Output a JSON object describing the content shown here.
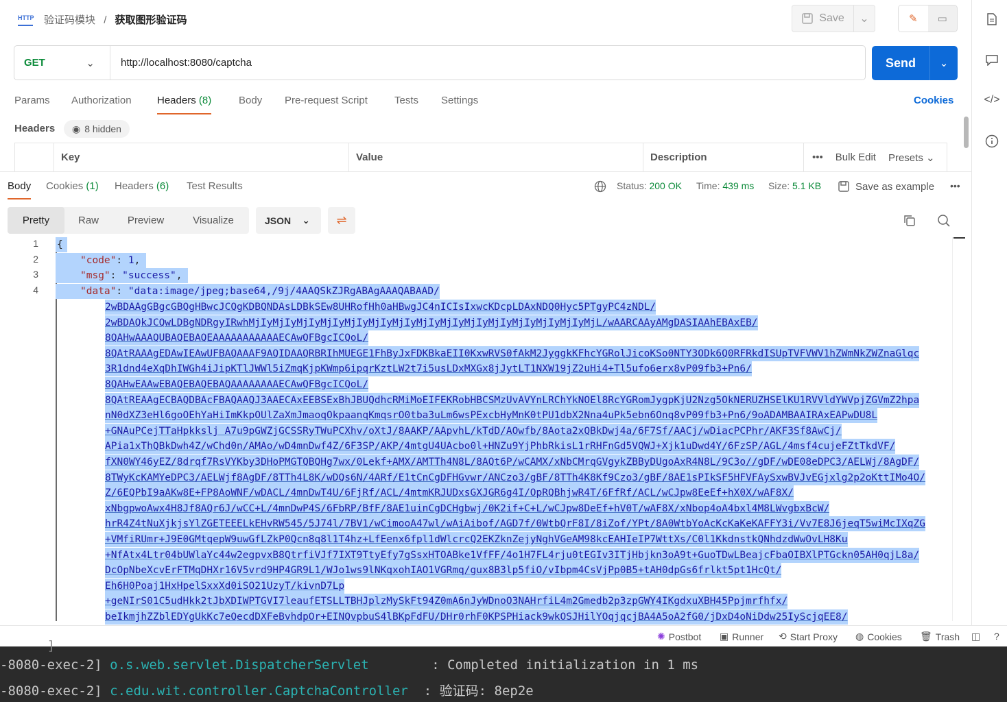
{
  "header": {
    "http_badge": "HTTP",
    "breadcrumb_parent": "验证码模块",
    "breadcrumb_sep": "/",
    "breadcrumb_current": "获取图形验证码",
    "save_label": "Save"
  },
  "request": {
    "method": "GET",
    "url": "http://localhost:8080/captcha",
    "send_label": "Send"
  },
  "req_tabs": [
    {
      "label": "Params"
    },
    {
      "label": "Authorization"
    },
    {
      "label": "Headers",
      "count": "(8)"
    },
    {
      "label": "Body"
    },
    {
      "label": "Pre-request Script"
    },
    {
      "label": "Tests"
    },
    {
      "label": "Settings"
    }
  ],
  "cookies_link": "Cookies",
  "headers_section": {
    "title": "Headers",
    "hidden": "8 hidden",
    "cols": [
      "Key",
      "Value",
      "Description"
    ],
    "bulk_edit": "Bulk Edit",
    "presets": "Presets"
  },
  "resp_tabs": [
    {
      "label": "Body"
    },
    {
      "label": "Cookies",
      "count": "(1)"
    },
    {
      "label": "Headers",
      "count": "(6)"
    },
    {
      "label": "Test Results"
    }
  ],
  "resp_meta": {
    "status_label": "Status:",
    "status_value": "200 OK",
    "time_label": "Time:",
    "time_value": "439 ms",
    "size_label": "Size:",
    "size_value": "5.1 KB",
    "save_example": "Save as example"
  },
  "view_modes": [
    "Pretty",
    "Raw",
    "Preview",
    "Visualize"
  ],
  "format": "JSON",
  "code": {
    "line_numbers": [
      "1",
      "2",
      "3",
      "4"
    ],
    "brace": "{",
    "code_key": "\"code\"",
    "code_val": "1",
    "msg_key": "\"msg\"",
    "msg_val": "\"success\"",
    "data_key": "\"data\"",
    "data_first": "\"data:image/jpeg;base64,/9j/4AAQSkZJRgABAgAAAQABAAD/",
    "data_lines": [
      "2wBDAAgGBgcGBQgHBwcJCQgKDBQNDAsLDBkSEw8UHRofHh0aHBwgJC4nICIsIxwcKDcpLDAxNDQ0Hyc5PTgyPC4zNDL/",
      "2wBDAQkJCQwLDBgNDRgyIRwhMjIyMjIyMjIyMjIyMjIyMjIyMjIyMjIyMjIyMjIyMjIyMjIyMjIyMjIyMjL/wAARCAAyAMgDASIAAhEBAxEB/",
      "8QAHwAAAQUBAQEBAQEAAAAAAAAAAAECAwQFBgcICQoL/",
      "8QAtRAAAgEDAwIEAwUFBAQAAAF9AQIDAAQRBRIhMUEGE1FhByJxFDKBkaEII0KxwRVS0fAkM2JyggkKFhcYGRolJicoKSo0NTY3ODk6Q0RFRkdISUpTVFVWV1hZWmNkZWZnaGlqc",
      "3R1dnd4eXqDhIWGh4iJipKTlJWWl5iZmqKjpKWmp6ipqrKztLW2t7i5usLDxMXGx8jJytLT1NXW19jZ2uHi4+Tl5ufo6erx8vP09fb3+Pn6/",
      "8QAHwEAAwEBAQEBAQEBAQAAAAAAAAECAwQFBgcICQoL/",
      "8QAtREAAgECBAQDBAcFBAQAAQJ3AAECAxEEBSExBhJBUQdhcRMiMoEIFEKRobHBCSMzUvAVYnLRChYkNOEl8RcYGRomJygpKjU2Nzg5OkNERUZHSElKU1RVVldYWVpjZGVmZ2hpa",
      "nN0dXZ3eHl6goOEhYaHiImKkpOUlZaXmJmaoqOkpaanqKmqsrO0tba3uLm6wsPExcbHyMnK0tPU1dbX2Nna4uPk5ebn6Onq8vP09fb3+Pn6/9oADAMBAAIRAxEAPwDU8L",
      "+GNAuPCejTTaHpkkslj A7u9pGWZjGCSSRyTWuPCXhv/oXtJ/8AAKP/AApvhL/kTdD/AOwfb/8Aota2xQBkDwj4a/6F7Sf/AACj/wDiacPCPhr/AKF3Sf8AwCj/",
      "APia1xThQBkDwh4Z/wChd0n/AMAo/wD4mnDwf4Z/6F3SP/AKP/4mtgU4UAcbo0l+HNZu9YjPhbRkisL1rRHFnGd5VQWJ+Xjk1uDwd4Y/6FzSP/AGL/4msf4cujeFZtTkdVF/",
      "fXN0WY46yEZ/8drqf7RsVYKby3DHoPMGTQBQHg7wx/0Lekf+AMX/AMTTh4N8L/8AQt6P/wCAMX/xNbCMrqGVgykZBByDUgoAxR4N8L/9C3o//gDF/wDE08eDPC3/AELWj/8AgDF/",
      "8TWyKcKAMYeDPC3/AELWjf8AgDF/8TTh4L8K/wDQs6N/4ARf/E1tCnCgDFHGvwr/ANCzo3/gBF/8TTh4K8Kf9Czo3/gBF/8AE1sPIkSF5HFVFAySxwBVJvEGjxlg2p2oKttIMo4O/",
      "Z/6EQPbI9aAKw8E+FP8AoWNF/wDACL/4mnDwT4U/6FjRf/ACL/4mtmKRJUDxsGXJGR6g4I/OpRQBhjwR4T/6FfRf/ACL/wCJpw8EeEf+hX0X/wAF8X/",
      "xNbgpwoAwx4H8Jf8AQr6J/wCC+L/4mnDwP4S/6FbRP/BfF/8AE1uinCgDCHgbwj/0K2if+C+L/wCJpw8DeEf+hV0T/wAF8X/xNbop4oA4bxl4M8LWvgbxBcW/",
      "hrR4Z4tNuXjkjsYlZGETEEELkEHvRW545/5J74l/7BV1/wCimooA47wl/wAiAibof/AGD7f/0WtbQrF8I/8iZof/YPt/8A0WtbYoAcKcKaKeKAFFY3i/Vv7E8J6jeqT5wiMcIXqZG",
      "+VMfiRUmr+J9E0GMtqepW9uwGfLZkP0Qcn8q8l1T4hz+LfEenx6fpl1dWlcrcQ2EKZknZejyNghVGeAM98kcEAHIeIP7WttXs/C0l1KkdnstkQNhdzdWwOvLH8Ku",
      "+NfAtx4Ltr04bUWlaYc44w2egpvxB8QtrfiVJf7IXT9TtyEfy7gSsxHTOABke1VfFF/4o1H7FL4rju0tEGIv3ITjHbjkn3oA9t+GuoTDwLBeajcFbaOIBXlPTGckn05AH0qjL8a/",
      "DcOpNbeXcvErFTMqDHXr16V5vrd9HP4GR9L1/WJo1ws9lNKqxohIAO1VGRmq/gux8B3lp5fiO/vIbpm4CsVjPp0B5+tAH0dpGs6frlkt5pt1HcQt/",
      "Eh6H0Poaj1HxHpelSxxXd0iSO21UzyT/kivnD7Lp",
      "+geNIrS01C5udHkk2tJbXDIWPTGVI7leaufETSLLTBHJplzMySkFt94Z0mA6nJyWDnoO3NAHrfiL4m2Gmedb2p3zpGWY4IKgdxuXBH45Ppjmrfhfx/",
      "beIkmjhZZblEDYgUkKc7eQecdDXFeBvhdpOr+EINQvpbuS4lBKpFdFU/DHr0rhF0KPSPHiack9wkOSJHilYOqjqcjBA4A5oA2fG0/jDxD4oNiDdw25IyScjqEE8/"
    ]
  },
  "statusbar": {
    "postbot": "Postbot",
    "runner": "Runner",
    "start_proxy": "Start Proxy",
    "cookies": "Cookies",
    "trash": "Trash"
  },
  "console": {
    "line1_thread": "-8080-exec-2]",
    "line1_logger": "o.s.web.servlet.DispatcherServlet",
    "line1_msg": ": Completed initialization in 1 ms",
    "line2_thread": "-8080-exec-2]",
    "line2_logger": "c.edu.wit.controller.CaptchaController",
    "line2_msg": ": 验证码: 8ep2e"
  },
  "colors": {
    "accent": "#e0662b",
    "send": "#0d6ad8",
    "green": "#0b8a39",
    "selection": "#b3d4fd"
  }
}
